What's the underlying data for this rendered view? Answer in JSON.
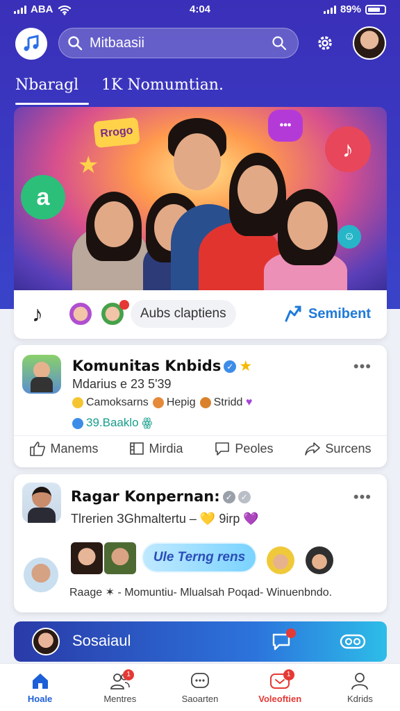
{
  "status_bar": {
    "carrier": "ABA",
    "time": "4:04",
    "battery": "89%"
  },
  "header": {
    "search_value": "Mitbaasii",
    "icons": [
      "music-note-icon",
      "search-icon",
      "gear-icon"
    ]
  },
  "tabs": [
    {
      "label": "Nbaragl",
      "active": true
    },
    {
      "label": "1K Nomumtian.",
      "active": false
    }
  ],
  "hero": {
    "banner_text": "Rrogo",
    "audio_label": "Aubs claptiens",
    "sentiment_label": "Semibent"
  },
  "card1": {
    "title": "Komunitas Knbids",
    "subtitle": "Mdarius e 23 5'39",
    "tags": [
      "Camoksarns",
      "Hepig",
      "Stridd"
    ],
    "link": "39.Baaklo ꙮ",
    "actions": [
      {
        "label": "Manems",
        "icon": "thumbs-up-icon"
      },
      {
        "label": "Mirdia",
        "icon": "media-icon"
      },
      {
        "label": "Peoles",
        "icon": "comment-icon"
      },
      {
        "label": "Surcens",
        "icon": "share-icon"
      }
    ]
  },
  "card2": {
    "title": "Ragar Konpernan:",
    "subtitle": "Tlrerien ЗGhmaltertu – 💛 9irp 💜",
    "cta": "Ule Terng rens",
    "captions": "Raage ✶ -  Momuntiu-   Mlualsah        Poqad-  Winuenbndo."
  },
  "social": {
    "label": "Sosaiaul"
  },
  "bottom_nav": [
    {
      "label": "Hoale",
      "icon": "home-icon",
      "active": true
    },
    {
      "label": "Mentres",
      "icon": "people-icon",
      "badge": "1"
    },
    {
      "label": "Saoarten",
      "icon": "chat-icon"
    },
    {
      "label": "Voleoftien",
      "icon": "video-icon",
      "badge": "1",
      "highlight": true
    },
    {
      "label": "Kdrids",
      "icon": "profile-icon"
    }
  ],
  "colors": {
    "primary": "#3a2fb8",
    "accent": "#1f7ad8",
    "alert": "#e53935"
  }
}
